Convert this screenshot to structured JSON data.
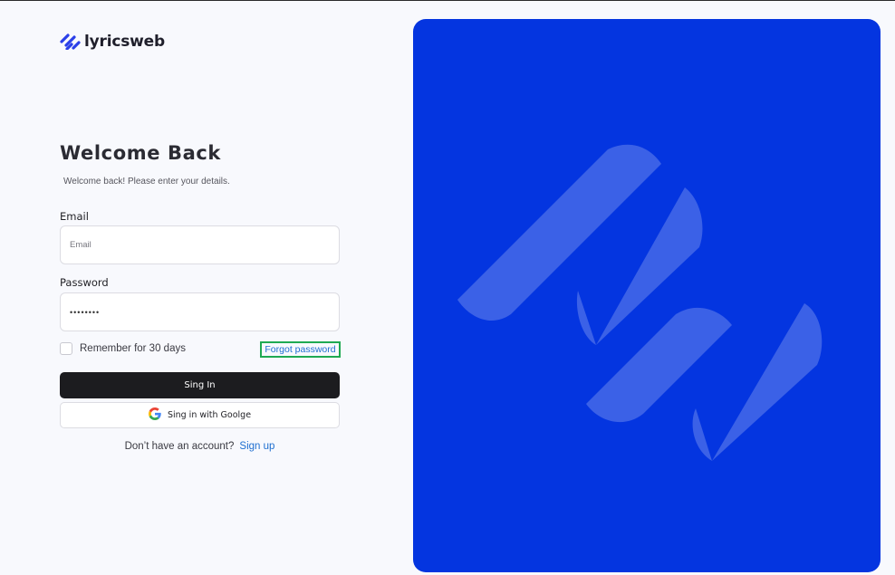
{
  "brand": {
    "name": "lyricsweb",
    "accent_color": "#2a3fe8",
    "panel_color": "#0435e0",
    "logo_icon": "lyricsweb-slashes-icon"
  },
  "login": {
    "title": "Welcome Back",
    "subtitle": "Welcome back! Please enter your details.",
    "email_label": "Email",
    "email_placeholder": "Email",
    "email_value": "",
    "password_label": "Password",
    "password_value": "••••••••",
    "remember_label": "Remember for 30 days",
    "remember_checked": false,
    "forgot_label": "Forgot password",
    "signin_label": "Sing In",
    "google_label": "Sing in with Goolge",
    "google_icon": "google-icon",
    "no_account_text": "Don’t have an account?",
    "signup_label": "Sign up"
  },
  "colors": {
    "primary_button": "#1c1c1f",
    "link": "#1f6fd0",
    "highlight_border": "#1faa52"
  }
}
